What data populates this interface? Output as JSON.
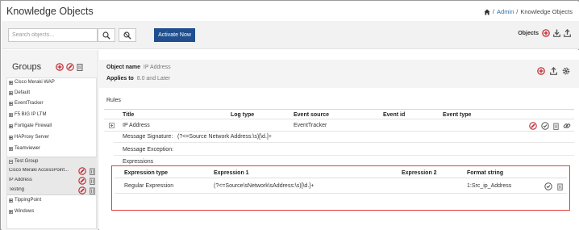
{
  "window": {
    "title": "Knowledge Objects"
  },
  "breadcrumb": {
    "home": "",
    "sep1": "/",
    "admin": "Admin",
    "sep2": "/",
    "current": "Knowledge Objects"
  },
  "toolbar": {
    "search_placeholder": "Search objects...",
    "activate_label": "Activate Now",
    "objects_label": "Objects"
  },
  "groups": {
    "title": "Groups",
    "items": [
      "Cisco Meraki WAP",
      "Default",
      "EventTracker",
      "F5 BIG IP LTM",
      "Fortigate Firewall",
      "HAProxy Server",
      "Teamviewer",
      "Test Group",
      "TippingPoint",
      "Windows"
    ],
    "test_group_children": [
      "Cisco Meraki AccessPoint...",
      "IP Address",
      "Testing"
    ]
  },
  "object": {
    "name_label": "Object name",
    "name_value": "IP Address",
    "applies_label": "Applies to",
    "applies_value": "8.0 and Later"
  },
  "rules": {
    "label": "Rules",
    "columns": [
      "Title",
      "Log type",
      "Event source",
      "Event id",
      "Event type"
    ],
    "row": {
      "title": "IP Address",
      "log_type": "",
      "event_source": "EventTracker",
      "event_id": "",
      "event_type": ""
    },
    "message_signature_label": "Message Signature:",
    "message_signature_value": "(?<=Source Network Address:\\s)[\\d.]+",
    "message_exception_label": "Message Exception:",
    "expressions_label": "Expressions"
  },
  "expressions": {
    "columns": [
      "Expression type",
      "Expression 1",
      "Expression 2",
      "Format string"
    ],
    "row": {
      "type": "Regular Expression",
      "expr1": "(?<=Source\\sNetwork\\sAddress:\\s)[\\d.]+",
      "expr2": "",
      "format": "1:Src_ip_Address"
    }
  },
  "colors": {
    "accent": "#1f4f8f",
    "highlight_border": "#e04040",
    "add_icon": "#c0272d",
    "link": "#2a6fb0"
  }
}
